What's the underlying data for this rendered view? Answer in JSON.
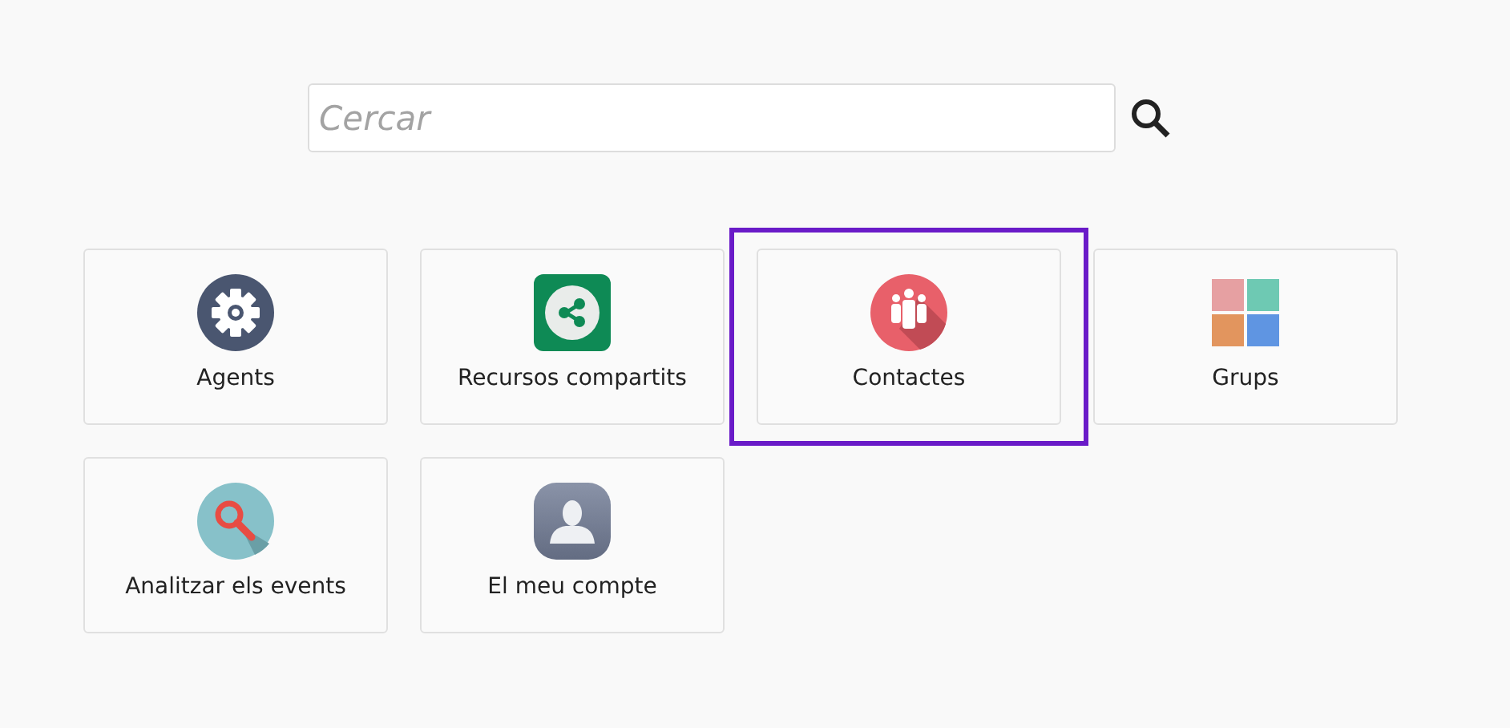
{
  "search": {
    "placeholder": "Cercar"
  },
  "tiles": [
    {
      "label": "Agents",
      "kind": "gear",
      "selected": false
    },
    {
      "label": "Recursos compartits",
      "kind": "share",
      "selected": false
    },
    {
      "label": "Contactes",
      "kind": "people",
      "selected": true
    },
    {
      "label": "Grups",
      "kind": "grid",
      "selected": false
    },
    {
      "label": "Analitzar els events",
      "kind": "magnifier",
      "selected": false
    },
    {
      "label": "El meu compte",
      "kind": "user",
      "selected": false
    }
  ]
}
